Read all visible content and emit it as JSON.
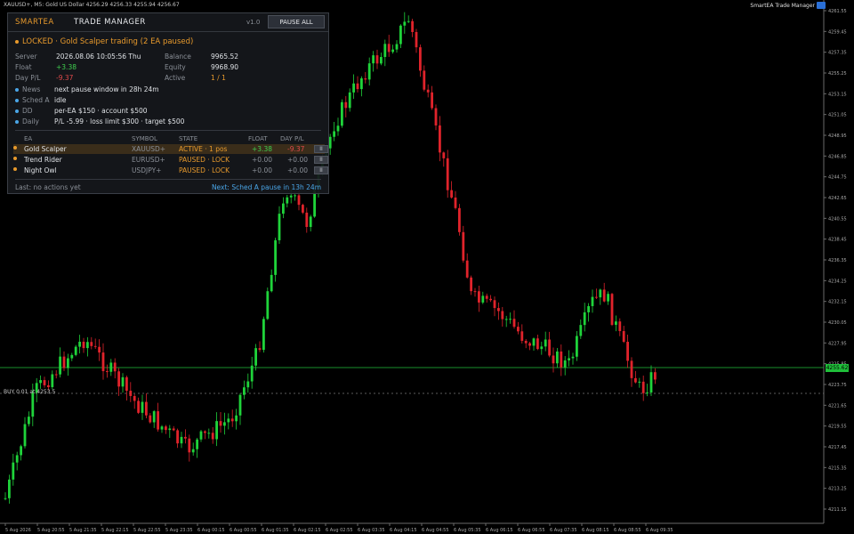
{
  "chart": {
    "symbol_line": "XAUUSD+, M5:  Gold US Dollar  4256.29 4256.33 4255.94 4256.67",
    "ea_label": "SmartEA Trade Manager",
    "buy_label": "BUY 0.01 at 4253.5",
    "current_price": "4255.62",
    "price_ticks": [
      "4261.55",
      "4259.45",
      "4257.35",
      "4255.25",
      "4253.15",
      "4251.05",
      "4248.95",
      "4246.85",
      "4244.75",
      "4242.65",
      "4240.55",
      "4238.45",
      "4236.35",
      "4234.25",
      "4232.15",
      "4230.05",
      "4227.95",
      "4225.85",
      "4223.75",
      "4221.65",
      "4219.55",
      "4217.45",
      "4215.35",
      "4213.25",
      "4211.15"
    ],
    "time_ticks": [
      "5 Aug 2026",
      "5 Aug 20:55",
      "5 Aug 21:35",
      "5 Aug 22:15",
      "5 Aug 22:55",
      "5 Aug 23:35",
      "6 Aug 00:15",
      "6 Aug 00:55",
      "6 Aug 01:35",
      "6 Aug 02:15",
      "6 Aug 02:55",
      "6 Aug 03:35",
      "6 Aug 04:15",
      "6 Aug 04:55",
      "6 Aug 05:35",
      "6 Aug 06:15",
      "6 Aug 06:55",
      "6 Aug 07:35",
      "6 Aug 08:15",
      "6 Aug 08:55",
      "6 Aug 09:35"
    ],
    "colors": {
      "bull": "#1fd33a",
      "bear": "#e0232b",
      "grid": "#3a3a3a",
      "price_line": "#1fbf3a"
    }
  },
  "panel": {
    "brand": "SMARTEA",
    "title": "TRADE MANAGER",
    "version": "v1.0",
    "pause_all_label": "PAUSE ALL",
    "status": "LOCKED · Gold Scalper trading  (2 EA paused)",
    "server_label": "Server",
    "server_value": "2026.08.06 10:05:56 Thu",
    "balance_label": "Balance",
    "balance_value": "9965.52",
    "float_label": "Float",
    "float_value": "+3.38",
    "equity_label": "Equity",
    "equity_value": "9968.90",
    "daypl_label": "Day P/L",
    "daypl_value": "-9.37",
    "active_label": "Active",
    "active_value": "1 / 1",
    "news_label": "News",
    "news_value": "next pause window in 28h 24m",
    "sched_label": "Sched A",
    "sched_value": "idle",
    "dd_label": "DD",
    "dd_value": "per-EA $150  ·  account $500",
    "daily_label": "Daily",
    "daily_value": "P/L -5.99  ·  loss limit $300  ·  target $500",
    "columns": {
      "ea": "EA",
      "symbol": "SYMBOL",
      "state": "STATE",
      "float": "FLOAT",
      "daypl": "DAY P/L"
    },
    "rows": [
      {
        "ea": "Gold Scalper",
        "symbol": "XAUUSD+",
        "state": "ACTIVE · 1 pos",
        "float": "+3.38",
        "daypl": "-9.37",
        "btn": "II"
      },
      {
        "ea": "Trend Rider",
        "symbol": "EURUSD+",
        "state": "PAUSED · LOCK",
        "float": "+0.00",
        "daypl": "+0.00",
        "btn": "II"
      },
      {
        "ea": "Night Owl",
        "symbol": "USDJPY+",
        "state": "PAUSED · LOCK",
        "float": "+0.00",
        "daypl": "+0.00",
        "btn": "II"
      }
    ],
    "last_label": "Last:  no actions yet",
    "next_label": "Next:  Sched A pause in 13h 24m"
  }
}
